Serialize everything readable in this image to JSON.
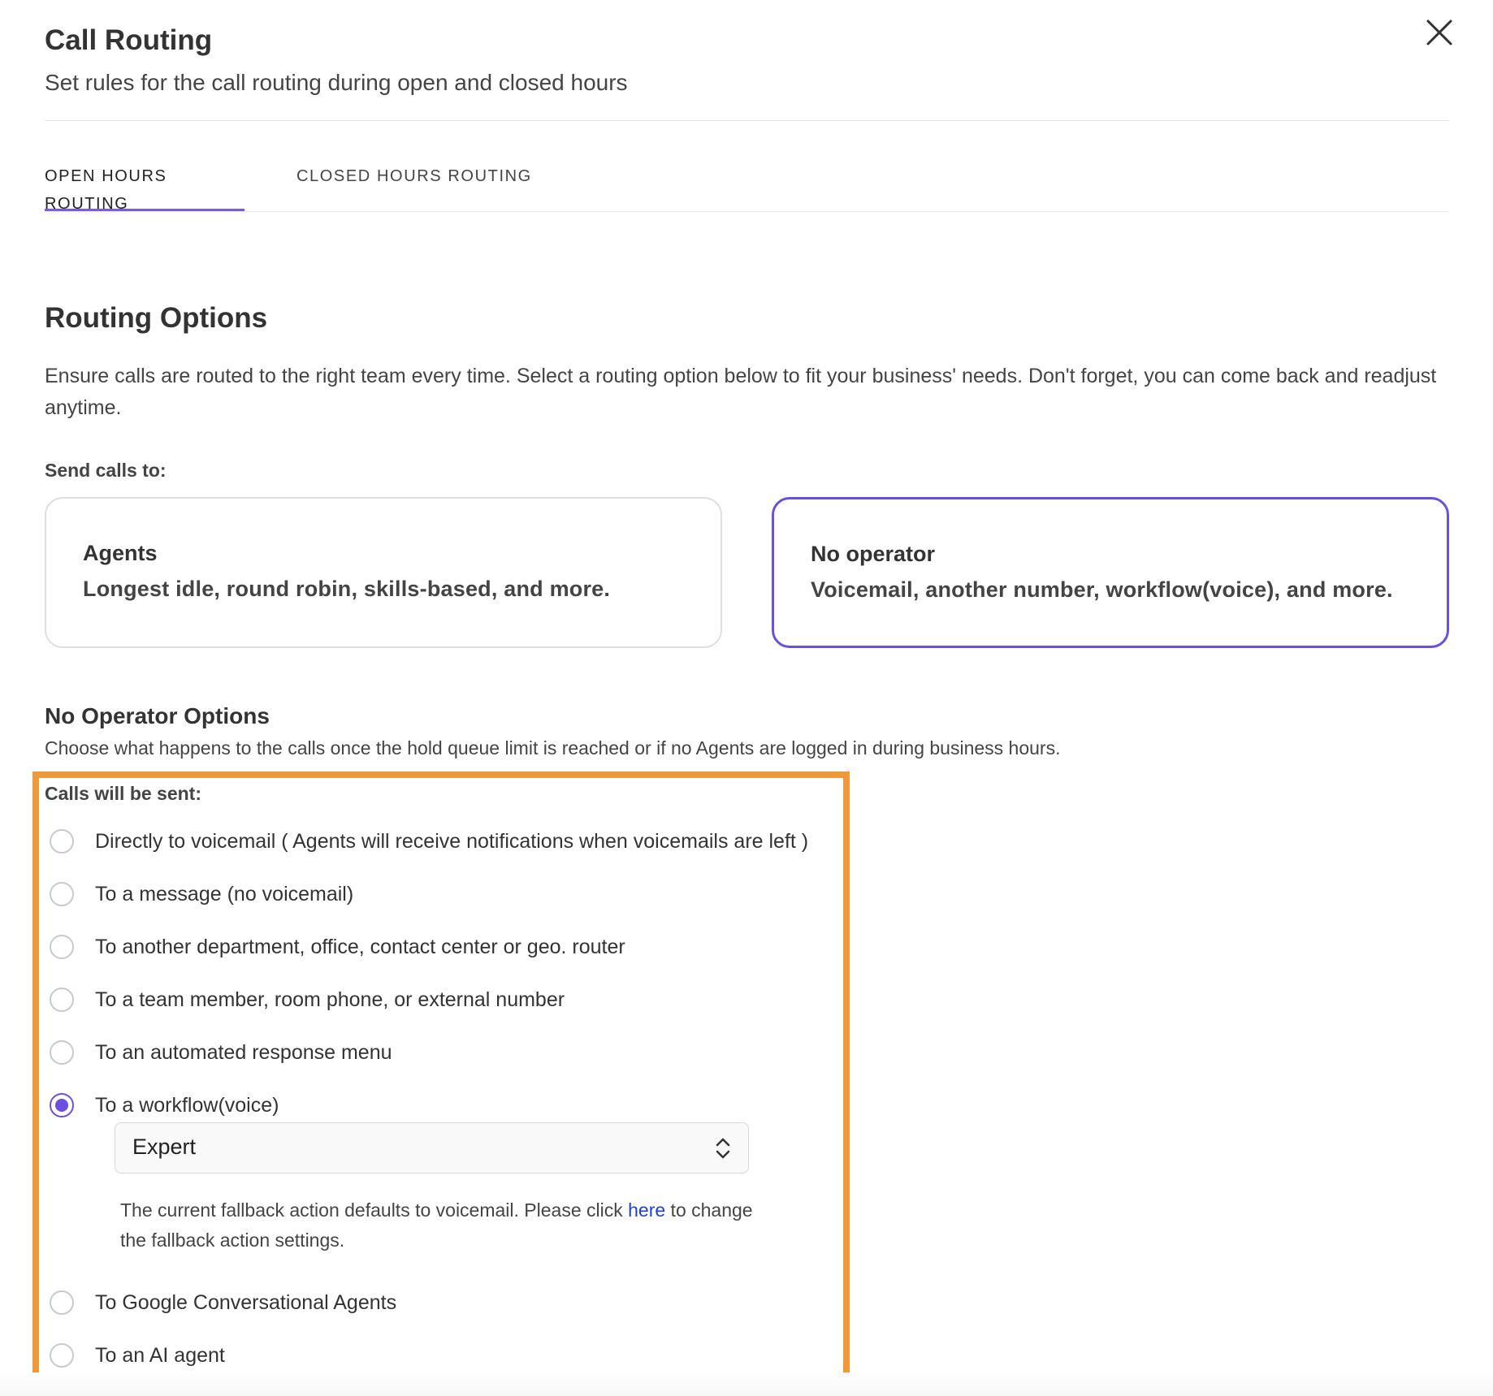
{
  "header": {
    "title": "Call Routing",
    "subtitle": "Set rules for the call routing during open and closed hours"
  },
  "tabs": [
    {
      "label": "OPEN HOURS ROUTING",
      "active": true
    },
    {
      "label": "CLOSED HOURS ROUTING",
      "active": false
    }
  ],
  "routing": {
    "title": "Routing Options",
    "description": "Ensure calls are routed to the right team every time. Select a routing option below to fit your business' needs. Don't forget, you can come back and readjust anytime.",
    "send_label": "Send calls to:",
    "cards": [
      {
        "title": "Agents",
        "subtitle": "Longest idle, round robin, skills-based, and more.",
        "selected": false
      },
      {
        "title": "No operator",
        "subtitle": "Voicemail, another number, workflow(voice), and more.",
        "selected": true
      }
    ]
  },
  "no_operator": {
    "title": "No Operator Options",
    "description": "Choose what happens to the calls once the hold queue limit is reached or if no Agents are logged in during business hours.",
    "calls_label": "Calls will be sent:",
    "options": [
      {
        "label": "Directly to voicemail ( Agents will receive notifications when voicemails are left )",
        "checked": false
      },
      {
        "label": "To a message (no voicemail)",
        "checked": false
      },
      {
        "label": "To another department, office, contact center or geo. router",
        "checked": false
      },
      {
        "label": "To a team member, room phone, or external number",
        "checked": false
      },
      {
        "label": "To an automated response menu",
        "checked": false
      },
      {
        "label": "To a workflow(voice)",
        "checked": true
      },
      {
        "label": "To Google Conversational Agents",
        "checked": false
      },
      {
        "label": "To an AI agent",
        "checked": false
      }
    ],
    "workflow_select": {
      "value": "Expert"
    },
    "fallback": {
      "text_before": "The current fallback action defaults to voicemail. Please click ",
      "link": "here",
      "text_after": " to change the fallback action settings."
    }
  },
  "colors": {
    "accent": "#6c4ee0",
    "highlight": "#f0993a",
    "link": "#1f3fd6"
  },
  "icons": [
    "close-icon",
    "select-arrows-icon"
  ]
}
